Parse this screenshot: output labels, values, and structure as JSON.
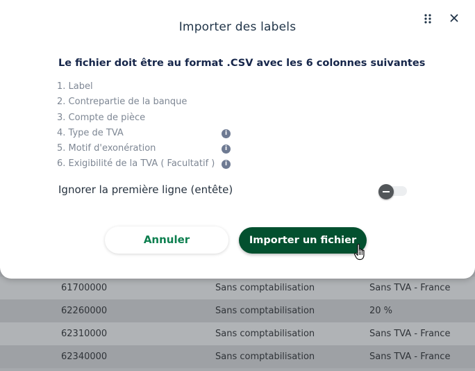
{
  "modal": {
    "title": "Importer des labels",
    "subtitle": "Le fichier doit être au format .CSV avec les 6 colonnes suivantes",
    "columns": [
      {
        "label": "1. Label",
        "info": false
      },
      {
        "label": "2. Contrepartie de la banque",
        "info": false
      },
      {
        "label": "3. Compte de pièce",
        "info": false
      },
      {
        "label": "4. Type de TVA",
        "info": true
      },
      {
        "label": "5. Motif d'exonération",
        "info": true
      },
      {
        "label": "6. Exigibilité de la TVA ( Facultatif )",
        "info": true
      }
    ],
    "ignore_first_line_label": "Ignorer la première ligne (entête)",
    "ignore_first_line_enabled": false,
    "cancel_label": "Annuler",
    "import_label": "Importer un fichier",
    "icons": {
      "drag": "drag-handle-icon",
      "close": "close-icon",
      "info": "info-icon",
      "cursor": "hand-pointer-icon"
    }
  },
  "background_table": {
    "rows": [
      [
        "61700000",
        "Sans comptabilisation",
        "Sans TVA - France"
      ],
      [
        "62260000",
        "Sans comptabilisation",
        "20 %"
      ],
      [
        "62310000",
        "Sans comptabilisation",
        "Sans TVA - France"
      ],
      [
        "62340000",
        "Sans comptabilisation",
        "Sans TVA - France"
      ]
    ]
  },
  "colors": {
    "primary_button": "#03502f",
    "accent_green": "#0d7f4f",
    "title_navy": "#16264a",
    "overlay": "#a6a9ad"
  }
}
